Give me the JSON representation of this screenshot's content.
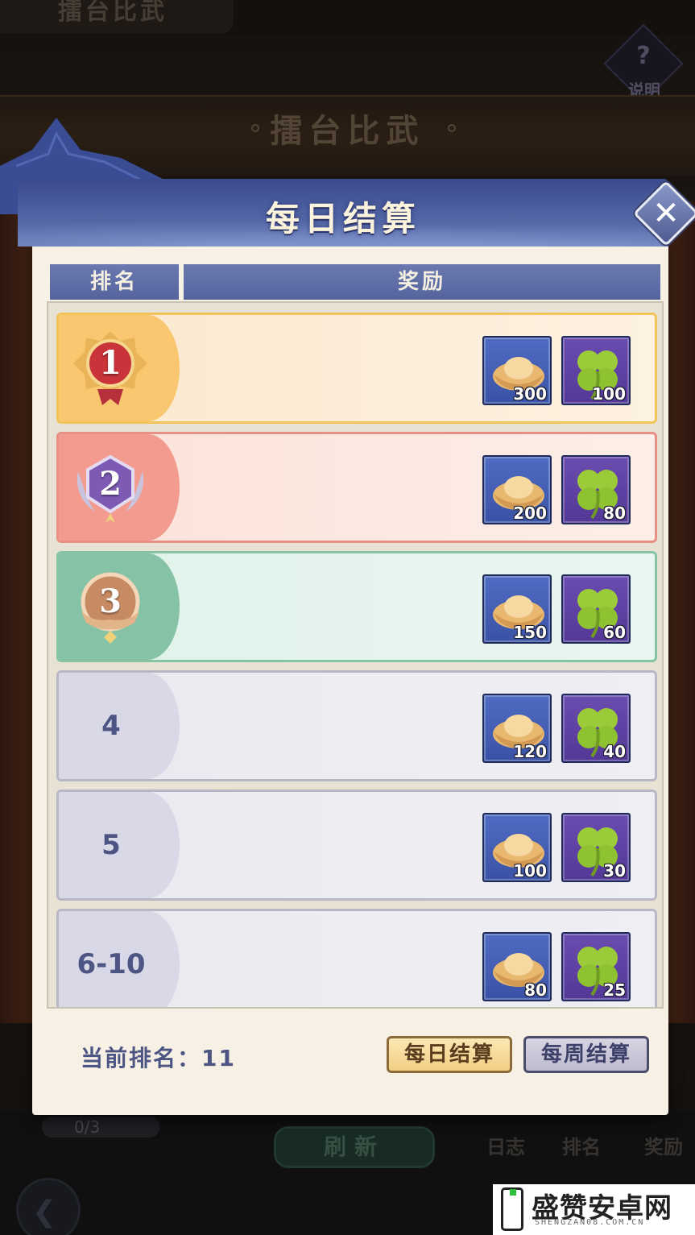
{
  "background": {
    "top_tab_title": "擂台比武",
    "help_label": "说明",
    "banner_title": "擂台比武",
    "progress_text": "0/3",
    "refresh_label": "刷新",
    "nav": [
      {
        "label": "日志"
      },
      {
        "label": "排名"
      },
      {
        "label": "奖励"
      }
    ]
  },
  "dialog": {
    "title": "每日结算",
    "columns": {
      "rank": "排名",
      "reward": "奖励"
    },
    "rows": [
      {
        "rank": "1",
        "medal": "gold-red",
        "gold_qty": "300",
        "clover_qty": "100"
      },
      {
        "rank": "2",
        "medal": "purple",
        "gold_qty": "200",
        "clover_qty": "80"
      },
      {
        "rank": "3",
        "medal": "bronze",
        "gold_qty": "150",
        "clover_qty": "60"
      },
      {
        "rank": "4",
        "medal": "",
        "gold_qty": "120",
        "clover_qty": "40"
      },
      {
        "rank": "5",
        "medal": "",
        "gold_qty": "100",
        "clover_qty": "30"
      },
      {
        "rank": "6-10",
        "medal": "",
        "gold_qty": "80",
        "clover_qty": "25"
      }
    ],
    "current_rank_label": "当前排名：11",
    "daily_button": "每日结算",
    "weekly_button": "每周结算"
  },
  "watermark": {
    "text": "盛赞安卓网",
    "sub": "SHENGZAN08.COM.CN"
  },
  "colors": {
    "row1": "#fbe8cf",
    "row2": "#fbe2d9",
    "row3": "#dff2ea",
    "row_plain": "#e8e8ef",
    "accent_blue": "#56649e"
  }
}
